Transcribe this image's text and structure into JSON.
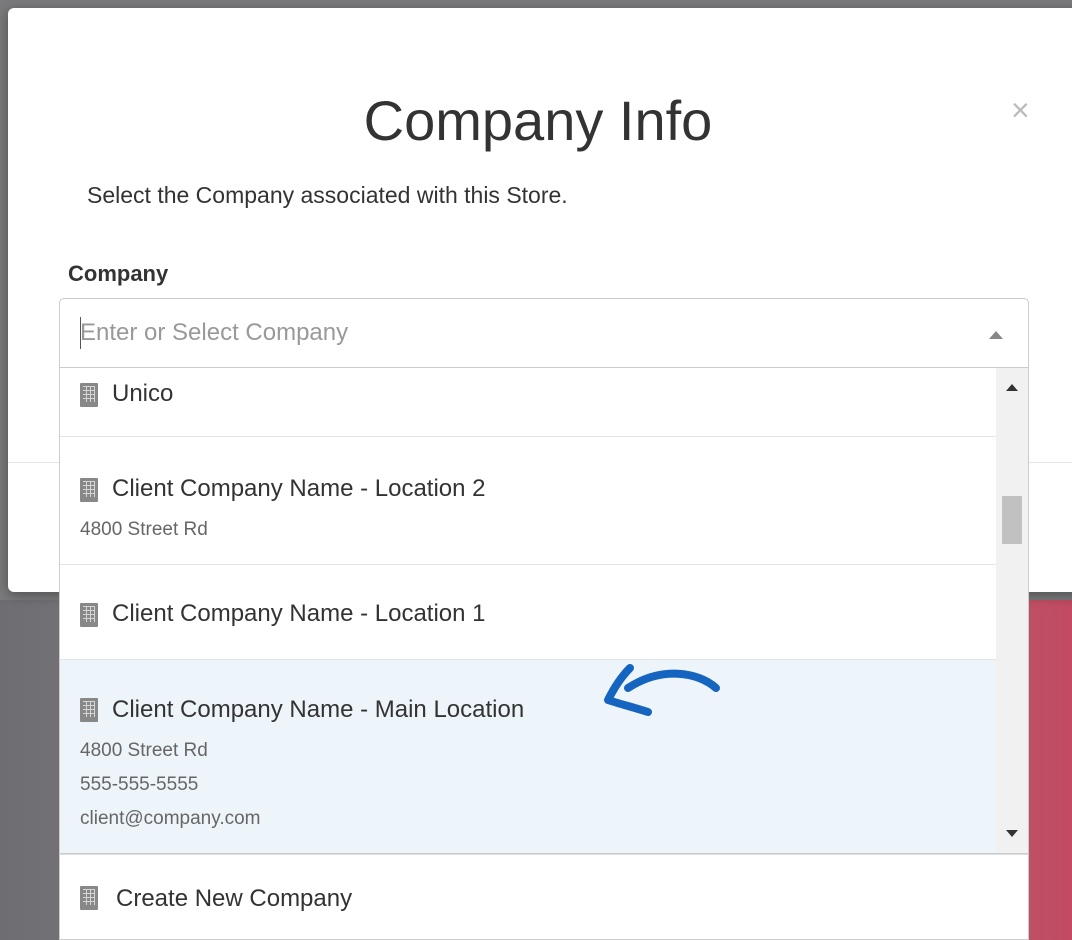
{
  "modal": {
    "title": "Company Info",
    "close": "×",
    "description": "Select the Company associated with this Store."
  },
  "company_field": {
    "label": "Company",
    "placeholder": "Enter or Select Company",
    "value": ""
  },
  "options": [
    {
      "title": "Unico",
      "lines": []
    },
    {
      "title": "Client Company Name - Location 2",
      "lines": [
        "4800 Street Rd"
      ]
    },
    {
      "title": "Client Company Name - Location 1",
      "lines": []
    },
    {
      "title": "Client Company Name - Main Location",
      "lines": [
        "4800 Street Rd",
        "555-555-5555",
        "client@company.com"
      ]
    }
  ],
  "create_new": {
    "label": "Create New Company"
  },
  "colors": {
    "highlight": "#edf4fa",
    "annotation": "#1565c0"
  },
  "icons": {
    "option": "building-icon",
    "close": "close-icon",
    "dropdown": "caret-up-icon"
  }
}
